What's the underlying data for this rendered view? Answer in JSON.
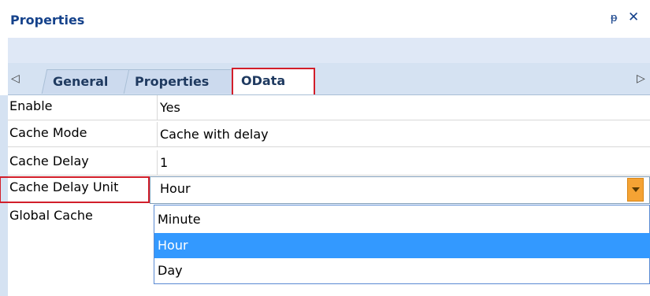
{
  "panel": {
    "title": "Properties",
    "pin_glyph": "ᵽ",
    "close_glyph": "✕"
  },
  "tabs": {
    "left_arrow": "◁",
    "right_arrow": "▷",
    "items": [
      {
        "label": "General"
      },
      {
        "label": "Properties"
      },
      {
        "label": "OData"
      }
    ],
    "active": "OData"
  },
  "properties": [
    {
      "name": "Enable",
      "value": "Yes"
    },
    {
      "name": "Cache Mode",
      "value": "Cache with delay"
    },
    {
      "name": "Cache Delay",
      "value": "1"
    },
    {
      "name": "Cache Delay Unit",
      "value": "Hour"
    },
    {
      "name": "Global Cache",
      "value": ""
    }
  ],
  "dropdown": {
    "selected": "Hour",
    "options": [
      "Minute",
      "Hour",
      "Day"
    ]
  },
  "colors": {
    "highlight_border": "#d21e2a",
    "selection": "#3399ff",
    "dropdown_button": "#f5a334"
  }
}
